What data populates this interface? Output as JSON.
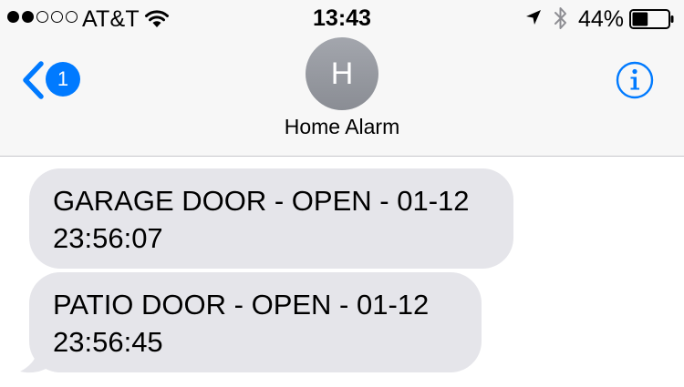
{
  "status_bar": {
    "signal_bars_filled": 2,
    "signal_bars_total": 5,
    "carrier": "AT&T",
    "time": "13:43",
    "battery_percent": "44%",
    "battery_level": 0.44,
    "icons": [
      "wifi-icon",
      "location-arrow-icon",
      "bluetooth-icon",
      "battery-icon"
    ]
  },
  "nav": {
    "back_badge": "1",
    "avatar_initial": "H",
    "contact_name": "Home Alarm",
    "info_icon": "info-icon",
    "accent_color": "#007aff"
  },
  "messages": [
    {
      "line1": "GARAGE DOOR - OPEN - 01-12",
      "line2": "23:56:07"
    },
    {
      "line1": "PATIO DOOR - OPEN - 01-12",
      "line2": "23:56:45"
    }
  ],
  "colors": {
    "received_bubble": "#e5e5ea",
    "header_bg": "#f7f7f7"
  }
}
